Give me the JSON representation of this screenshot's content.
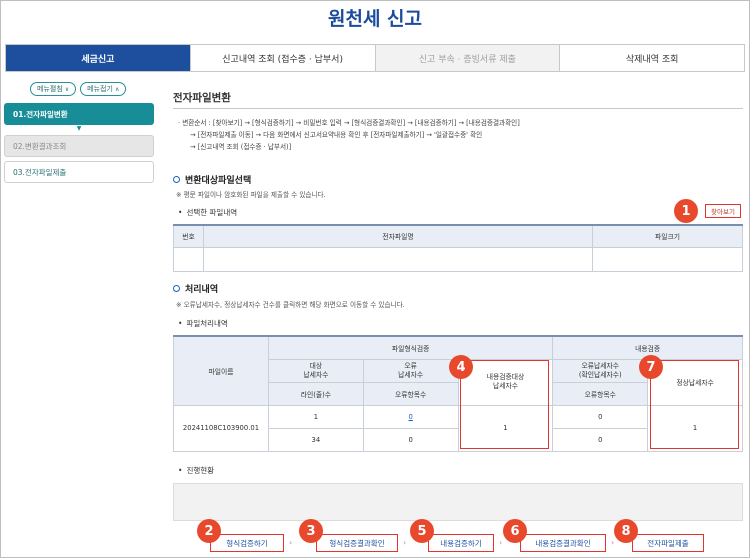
{
  "page_title": "원천세 신고",
  "tabs": [
    {
      "label": "세금신고",
      "state": "active"
    },
    {
      "label": "신고내역 조회 (접수증 · 납부서)",
      "state": "normal"
    },
    {
      "label": "신고 부속 · 증빙서류 제출",
      "state": "disabled"
    },
    {
      "label": "삭제내역 조회",
      "state": "normal"
    }
  ],
  "sidebar": {
    "expand_label": "메뉴펼침",
    "collapse_label": "메뉴접기",
    "items": [
      "01.전자파일변환",
      "02.변환결과조회",
      "03.전자파일제출"
    ]
  },
  "section_heading": "전자파일변환",
  "steps": [
    "· 변환순서 : [찾아보기] → [형식검증하기] → 비밀번호 입력 → [형식검증결과확인] → [내용검증하기] → [내용검증결과확인]",
    "→ [전자파일제출 이동] → 다음 화면에서 신고서요약내용 확인 후 [전자파일제출하기] → '일괄접수중' 확인",
    "→ [신고내역 조회 (접수증 · 납부서)]"
  ],
  "file_select": {
    "title": "변환대상파일선택",
    "note": "※ 평문 파일이나 암호화된 파일을 제출할 수 있습니다.",
    "subtitle": "선택한 파일내역",
    "find_button": "찾아보기",
    "columns": [
      "번호",
      "전자파일명",
      "파일크기"
    ]
  },
  "processing": {
    "title": "처리내역",
    "note": "※ 오류납세자수, 정상납세자수 건수를 클릭하면 해당 화면으로 이동할 수 있습니다.",
    "subtitle": "파일처리내역",
    "headers": {
      "file_name": "파일이름",
      "format_check": "파일형식검증",
      "content_check": "내용검증",
      "target_taxpayers": "대상\n납세자수",
      "error_count": "오류\n납세자수",
      "line_count": "라인(줄)수",
      "error_items": "오류항목수",
      "content_target": "내용검증대상\n납세자수",
      "content_error": "오류납세자수\n(확인납세자수)",
      "content_error_items": "오류항목수",
      "normal_taxpayers": "정상납세자수"
    },
    "row": {
      "file_name": "20241108C103900.01",
      "target_taxpayers": "1",
      "error_count": "0",
      "line_count": "34",
      "error_items": "0",
      "content_target": "1",
      "content_error": "0",
      "content_error_items": "0",
      "normal_taxpayers": "1"
    }
  },
  "progress": {
    "subtitle": "진행현황"
  },
  "bottom_buttons": [
    "형식검증하기",
    "형식검증결과확인",
    "내용검증하기",
    "내용검증결과확인",
    "전자파일제출"
  ],
  "badges": [
    "1",
    "2",
    "3",
    "4",
    "5",
    "6",
    "7",
    "8"
  ],
  "colors": {
    "brand_blue": "#1d4f9e",
    "teal": "#178d98",
    "highlight_red": "#e3342f",
    "badge_orange": "#e8482c"
  }
}
